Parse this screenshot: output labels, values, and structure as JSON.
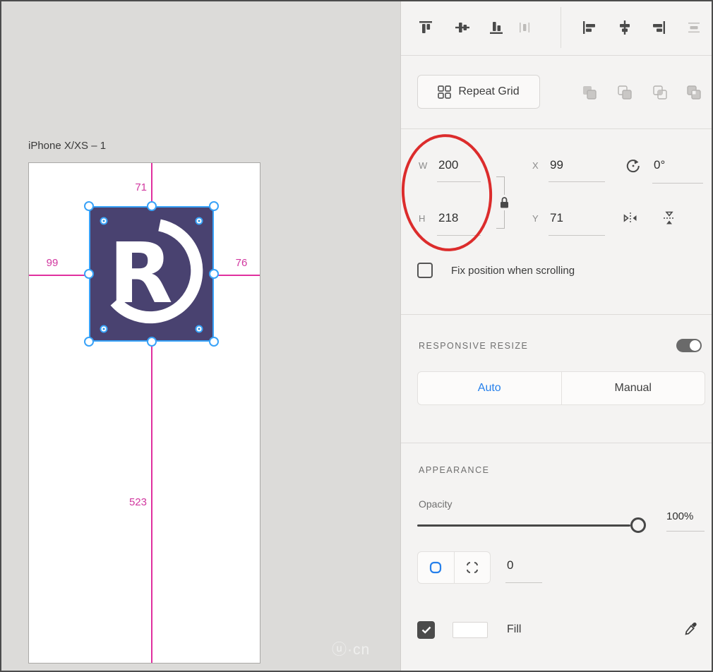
{
  "canvas": {
    "artboard_title": "iPhone X/XS – 1",
    "measurements": {
      "top": "71",
      "left": "99",
      "right": "76",
      "bottom": "523"
    },
    "logo": {
      "letter": "R",
      "bg_color": "#494270"
    },
    "watermark": "ⓤ·cn"
  },
  "panel": {
    "repeat_grid_label": "Repeat Grid",
    "transform": {
      "w_label": "W",
      "w_value": "200",
      "x_label": "X",
      "x_value": "99",
      "rotation_value": "0°",
      "h_label": "H",
      "h_value": "218",
      "y_label": "Y",
      "y_value": "71"
    },
    "fix_position_label": "Fix position when scrolling",
    "responsive": {
      "title": "RESPONSIVE RESIZE",
      "auto_label": "Auto",
      "manual_label": "Manual"
    },
    "appearance": {
      "title": "APPEARANCE",
      "opacity_label": "Opacity",
      "opacity_value": "100%",
      "corner_radius_value": "0",
      "fill_label": "Fill"
    },
    "colors": {
      "accent_blue": "#2680eb",
      "selection_blue": "#38a2f8",
      "guide_magenta": "#e0309f",
      "annotation_red": "#dc2c2c"
    }
  }
}
